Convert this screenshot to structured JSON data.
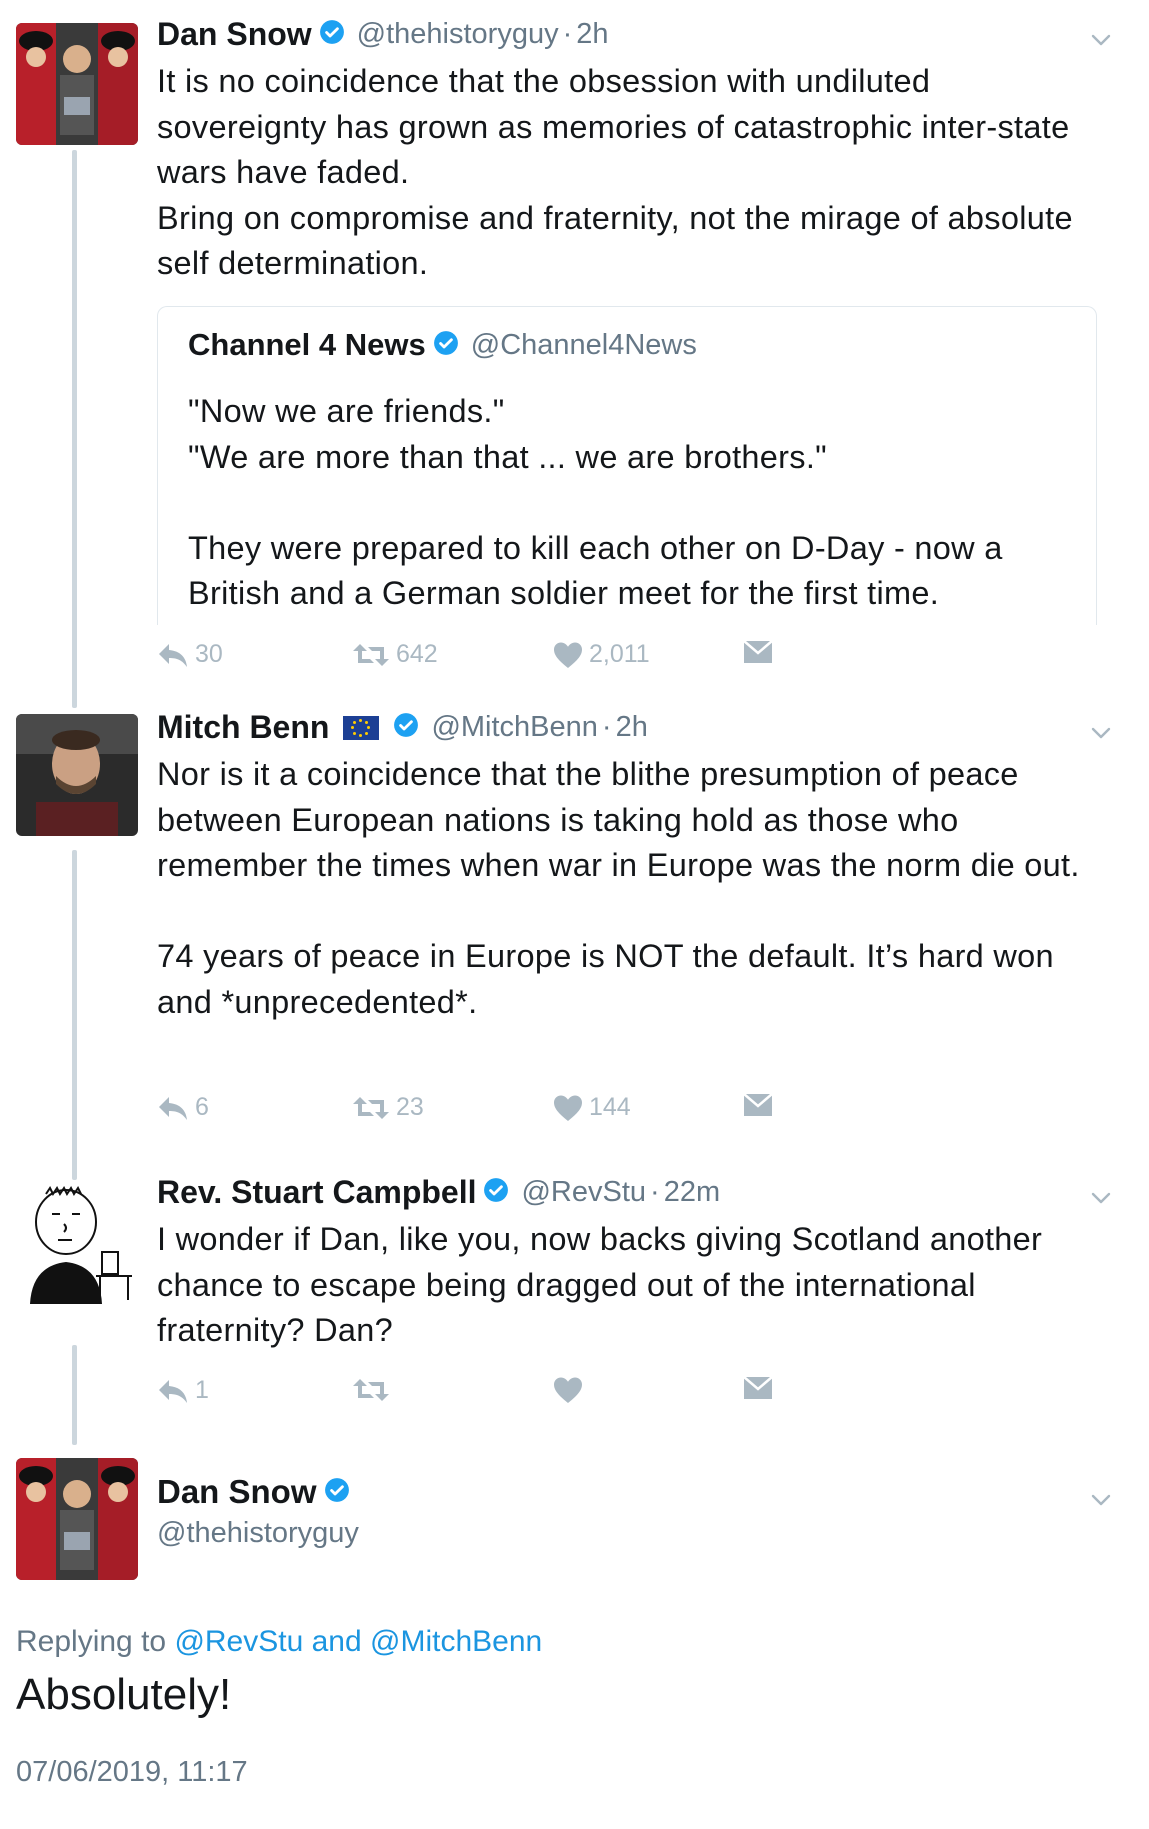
{
  "colors": {
    "accent": "#1b95e0",
    "verified": "#1da1f2",
    "muted": "#657786",
    "action_icon": "#aab8c2",
    "thread_line": "#ccd6dd"
  },
  "tweets": [
    {
      "name": "Dan Snow",
      "handle": "@thehistoryguy",
      "separator": "·",
      "time": "2h",
      "avatar_icon": "dan-snow-avatar",
      "text": "It is no coincidence that the obsession with undiluted sovereignty has grown as memories of catastrophic inter-state wars have faded.\nBring on compromise and fraternity, not the mirage of absolute self determination.",
      "quote": {
        "name": "Channel 4 News",
        "handle": "@Channel4News",
        "text": "\"Now we are friends.\"\n\"We are more than that ... we are brothers.\"\n\nThey were prepared to kill each other on D-Day - now a British and a German soldier meet for the first time."
      },
      "replies": "30",
      "retweets": "642",
      "likes": "2,011"
    },
    {
      "name": "Mitch Benn",
      "handle": "@MitchBenn",
      "separator": "·",
      "time": "2h",
      "flag_icon": "eu-flag-icon",
      "avatar_icon": "mitch-benn-avatar",
      "text": "Nor is it a coincidence that the blithe presumption of peace between European nations is taking hold as those who remember the times when war in Europe was the norm die out.\n\n74 years of peace in Europe is NOT the default. It’s hard won and *unprecedented*.",
      "replies": "6",
      "retweets": "23",
      "likes": "144"
    },
    {
      "name": "Rev. Stuart Campbell",
      "handle": "@RevStu",
      "separator": "·",
      "time": "22m",
      "avatar_icon": "cartoon-avatar",
      "text": "I wonder if Dan, like you, now backs giving Scotland another chance to escape being dragged out of the international fraternity? Dan?",
      "replies": "1",
      "retweets": "",
      "likes": ""
    }
  ],
  "focused_tweet": {
    "name": "Dan Snow",
    "handle": "@thehistoryguy",
    "replying_prefix": "Replying to",
    "replying_user1": "@RevStu",
    "replying_and": "and",
    "replying_user2": "@MitchBenn",
    "text": "Absolutely!",
    "timestamp": "07/06/2019, 11:17"
  }
}
